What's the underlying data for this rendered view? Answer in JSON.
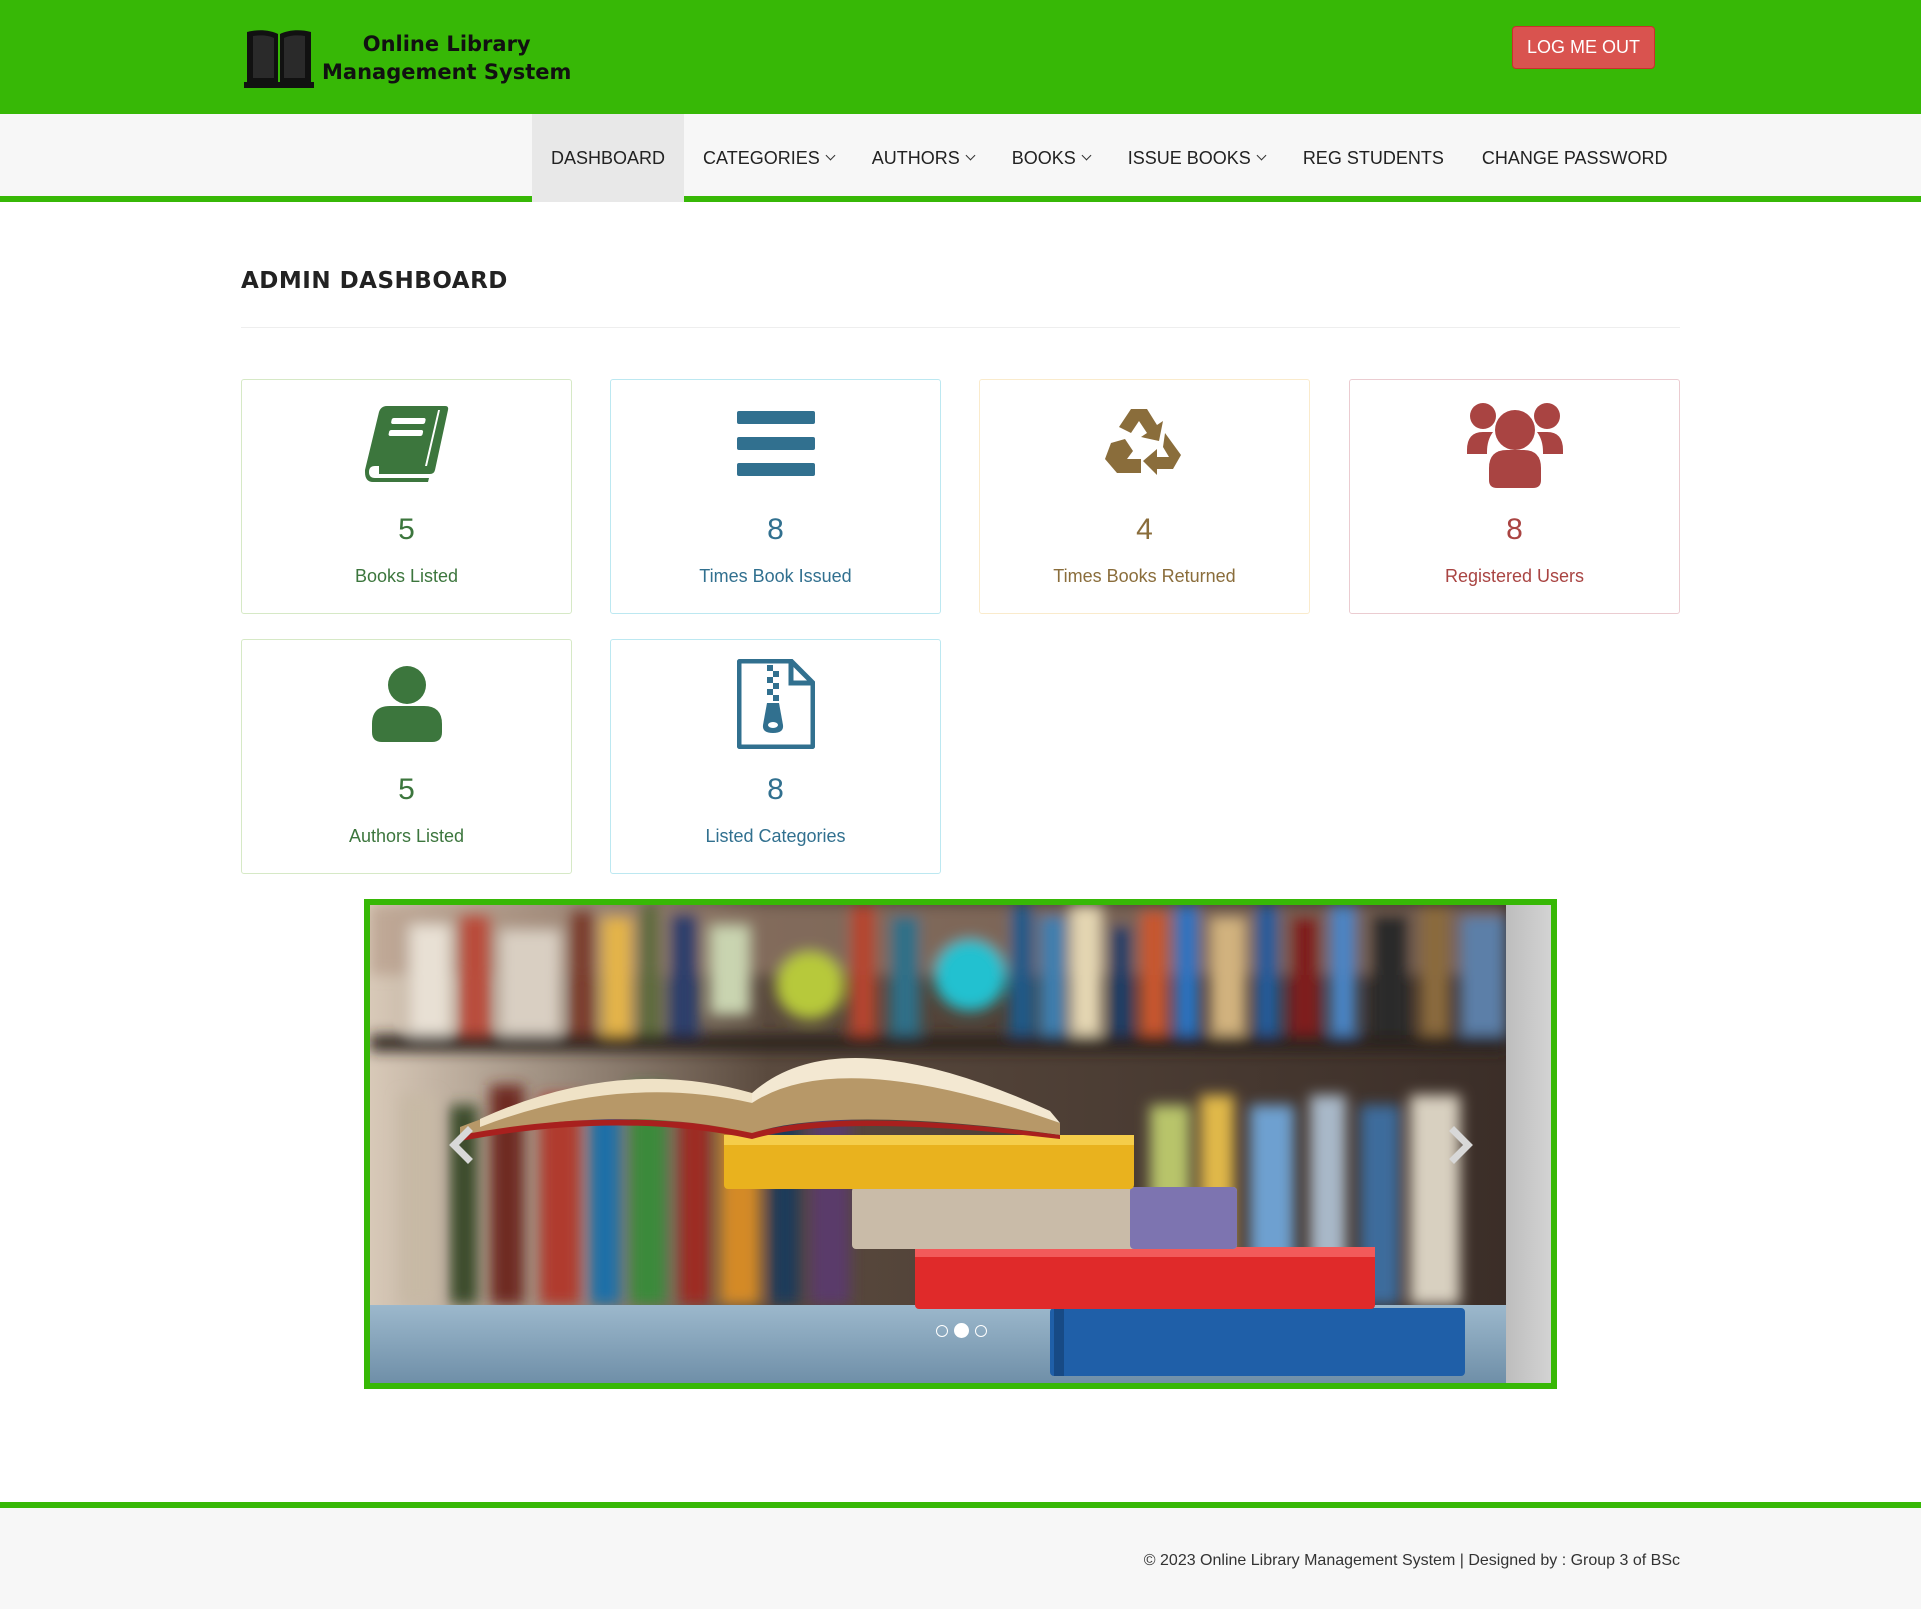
{
  "brand": {
    "line1": "Online Library",
    "line2": "Management System",
    "icon": "book-open-icon"
  },
  "header": {
    "logout_label": "LOG ME OUT"
  },
  "nav": {
    "items": [
      {
        "label": "DASHBOARD",
        "active": true,
        "dropdown": false
      },
      {
        "label": "CATEGORIES",
        "active": false,
        "dropdown": true
      },
      {
        "label": "AUTHORS",
        "active": false,
        "dropdown": true
      },
      {
        "label": "BOOKS",
        "active": false,
        "dropdown": true
      },
      {
        "label": "ISSUE BOOKS",
        "active": false,
        "dropdown": true
      },
      {
        "label": "REG STUDENTS",
        "active": false,
        "dropdown": false
      },
      {
        "label": "CHANGE PASSWORD",
        "active": false,
        "dropdown": false
      }
    ]
  },
  "page": {
    "title": "ADMIN DASHBOARD"
  },
  "cards": [
    {
      "value": "5",
      "label": "Books Listed",
      "icon": "book-icon",
      "color": "#3c763d"
    },
    {
      "value": "8",
      "label": "Times Book Issued",
      "icon": "bars-icon",
      "color": "#31708f"
    },
    {
      "value": "4",
      "label": "Times Books Returned",
      "icon": "recycle-icon",
      "color": "#8a6d3b"
    },
    {
      "value": "8",
      "label": "Registered Users",
      "icon": "users-icon",
      "color": "#a94442"
    },
    {
      "value": "5",
      "label": "Authors Listed",
      "icon": "user-icon",
      "color": "#3c763d"
    },
    {
      "value": "8",
      "label": "Listed Categories",
      "icon": "file-archive-icon",
      "color": "#31708f"
    }
  ],
  "carousel": {
    "slide_count": 3,
    "active_index": 1
  },
  "footer": {
    "text": "© 2023 Online Library Management System | Designed by : Group 3 of BSc"
  },
  "colors": {
    "brand_green": "#37b806",
    "danger": "#d9534f"
  }
}
